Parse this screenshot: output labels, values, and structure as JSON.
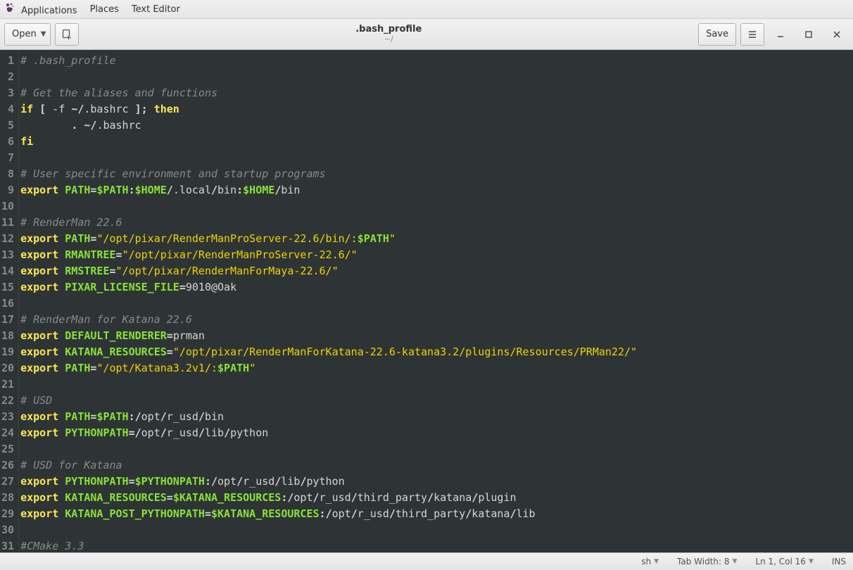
{
  "panel": {
    "applications": "Applications",
    "places": "Places",
    "texteditor": "Text Editor"
  },
  "toolbar": {
    "open": "Open",
    "save": "Save",
    "filename": ".bash_profile",
    "filepath": "~/"
  },
  "statusbar": {
    "lang": "sh",
    "tabwidth": "Tab Width: 8",
    "position": "Ln 1, Col 16",
    "ins": "INS"
  },
  "code": {
    "lines": [
      {
        "n": 1,
        "tokens": [
          [
            "comment",
            "# .bash_profile"
          ]
        ]
      },
      {
        "n": 2,
        "tokens": []
      },
      {
        "n": 3,
        "tokens": [
          [
            "comment",
            "# Get the aliases and functions"
          ]
        ]
      },
      {
        "n": 4,
        "tokens": [
          [
            "kw",
            "if"
          ],
          [
            "plain",
            " "
          ],
          [
            "op",
            "["
          ],
          [
            "plain",
            " -f "
          ],
          [
            "op",
            "~/"
          ],
          [
            "plain",
            ".bashrc "
          ],
          [
            "op",
            "];"
          ],
          [
            "plain",
            " "
          ],
          [
            "kw",
            "then"
          ]
        ]
      },
      {
        "n": 5,
        "tokens": [
          [
            "plain",
            "        "
          ],
          [
            "op",
            ". ~/"
          ],
          [
            "plain",
            ".bashrc"
          ]
        ]
      },
      {
        "n": 6,
        "tokens": [
          [
            "kw",
            "fi"
          ]
        ]
      },
      {
        "n": 7,
        "tokens": []
      },
      {
        "n": 8,
        "tokens": [
          [
            "comment",
            "# User specific environment and startup programs"
          ]
        ]
      },
      {
        "n": 9,
        "tokens": [
          [
            "kw",
            "export"
          ],
          [
            "plain",
            " "
          ],
          [
            "var",
            "PATH"
          ],
          [
            "op",
            "="
          ],
          [
            "env",
            "$PATH"
          ],
          [
            "op",
            ":"
          ],
          [
            "env",
            "$HOME"
          ],
          [
            "op",
            "/"
          ],
          [
            "plain",
            ".local"
          ],
          [
            "op",
            "/"
          ],
          [
            "plain",
            "bin"
          ],
          [
            "op",
            ":"
          ],
          [
            "env",
            "$HOME"
          ],
          [
            "op",
            "/"
          ],
          [
            "plain",
            "bin"
          ]
        ]
      },
      {
        "n": 10,
        "tokens": []
      },
      {
        "n": 11,
        "tokens": [
          [
            "comment",
            "# RenderMan 22.6"
          ]
        ]
      },
      {
        "n": 12,
        "tokens": [
          [
            "kw",
            "export"
          ],
          [
            "plain",
            " "
          ],
          [
            "var",
            "PATH"
          ],
          [
            "op",
            "="
          ],
          [
            "str",
            "\"/opt/pixar/RenderManProServer-22.6/bin/:"
          ],
          [
            "env",
            "$PATH"
          ],
          [
            "str",
            "\""
          ]
        ]
      },
      {
        "n": 13,
        "tokens": [
          [
            "kw",
            "export"
          ],
          [
            "plain",
            " "
          ],
          [
            "var",
            "RMANTREE"
          ],
          [
            "op",
            "="
          ],
          [
            "str",
            "\"/opt/pixar/RenderManProServer-22.6/\""
          ]
        ]
      },
      {
        "n": 14,
        "tokens": [
          [
            "kw",
            "export"
          ],
          [
            "plain",
            " "
          ],
          [
            "var",
            "RMSTREE"
          ],
          [
            "op",
            "="
          ],
          [
            "str",
            "\"/opt/pixar/RenderManForMaya-22.6/\""
          ]
        ]
      },
      {
        "n": 15,
        "tokens": [
          [
            "kw",
            "export"
          ],
          [
            "plain",
            " "
          ],
          [
            "var",
            "PIXAR_LICENSE_FILE"
          ],
          [
            "op",
            "="
          ],
          [
            "plain",
            "9010@Oak"
          ]
        ]
      },
      {
        "n": 16,
        "tokens": []
      },
      {
        "n": 17,
        "tokens": [
          [
            "comment",
            "# RenderMan for Katana 22.6"
          ]
        ]
      },
      {
        "n": 18,
        "tokens": [
          [
            "kw",
            "export"
          ],
          [
            "plain",
            " "
          ],
          [
            "var",
            "DEFAULT_RENDERER"
          ],
          [
            "op",
            "="
          ],
          [
            "plain",
            "prman"
          ]
        ]
      },
      {
        "n": 19,
        "tokens": [
          [
            "kw",
            "export"
          ],
          [
            "plain",
            " "
          ],
          [
            "var",
            "KATANA_RESOURCES"
          ],
          [
            "op",
            "="
          ],
          [
            "str",
            "\"/opt/pixar/RenderManForKatana-22.6-katana3.2/plugins/Resources/PRMan22/\""
          ]
        ]
      },
      {
        "n": 20,
        "tokens": [
          [
            "kw",
            "export"
          ],
          [
            "plain",
            " "
          ],
          [
            "var",
            "PATH"
          ],
          [
            "op",
            "="
          ],
          [
            "str",
            "\"/opt/Katana3.2v1/:"
          ],
          [
            "env",
            "$PATH"
          ],
          [
            "str",
            "\""
          ]
        ]
      },
      {
        "n": 21,
        "tokens": []
      },
      {
        "n": 22,
        "tokens": [
          [
            "comment",
            "# USD"
          ]
        ]
      },
      {
        "n": 23,
        "tokens": [
          [
            "kw",
            "export"
          ],
          [
            "plain",
            " "
          ],
          [
            "var",
            "PATH"
          ],
          [
            "op",
            "="
          ],
          [
            "env",
            "$PATH"
          ],
          [
            "op",
            ":/"
          ],
          [
            "plain",
            "opt"
          ],
          [
            "op",
            "/"
          ],
          [
            "plain",
            "r_usd"
          ],
          [
            "op",
            "/"
          ],
          [
            "plain",
            "bin"
          ]
        ]
      },
      {
        "n": 24,
        "tokens": [
          [
            "kw",
            "export"
          ],
          [
            "plain",
            " "
          ],
          [
            "var",
            "PYTHONPATH"
          ],
          [
            "op",
            "=/"
          ],
          [
            "plain",
            "opt"
          ],
          [
            "op",
            "/"
          ],
          [
            "plain",
            "r_usd"
          ],
          [
            "op",
            "/"
          ],
          [
            "plain",
            "lib"
          ],
          [
            "op",
            "/"
          ],
          [
            "plain",
            "python"
          ]
        ]
      },
      {
        "n": 25,
        "tokens": []
      },
      {
        "n": 26,
        "tokens": [
          [
            "comment",
            "# USD for Katana"
          ]
        ]
      },
      {
        "n": 27,
        "tokens": [
          [
            "kw",
            "export"
          ],
          [
            "plain",
            " "
          ],
          [
            "var",
            "PYTHONPATH"
          ],
          [
            "op",
            "="
          ],
          [
            "env",
            "$PYTHONPATH"
          ],
          [
            "op",
            ":/"
          ],
          [
            "plain",
            "opt"
          ],
          [
            "op",
            "/"
          ],
          [
            "plain",
            "r_usd"
          ],
          [
            "op",
            "/"
          ],
          [
            "plain",
            "lib"
          ],
          [
            "op",
            "/"
          ],
          [
            "plain",
            "python"
          ]
        ]
      },
      {
        "n": 28,
        "tokens": [
          [
            "kw",
            "export"
          ],
          [
            "plain",
            " "
          ],
          [
            "var",
            "KATANA_RESOURCES"
          ],
          [
            "op",
            "="
          ],
          [
            "env",
            "$KATANA_RESOURCES"
          ],
          [
            "op",
            ":/"
          ],
          [
            "plain",
            "opt"
          ],
          [
            "op",
            "/"
          ],
          [
            "plain",
            "r_usd"
          ],
          [
            "op",
            "/"
          ],
          [
            "plain",
            "third_party"
          ],
          [
            "op",
            "/"
          ],
          [
            "plain",
            "katana"
          ],
          [
            "op",
            "/"
          ],
          [
            "plain",
            "plugin"
          ]
        ]
      },
      {
        "n": 29,
        "tokens": [
          [
            "kw",
            "export"
          ],
          [
            "plain",
            " "
          ],
          [
            "var",
            "KATANA_POST_PYTHONPATH"
          ],
          [
            "op",
            "="
          ],
          [
            "env",
            "$KATANA_RESOURCES"
          ],
          [
            "op",
            ":/"
          ],
          [
            "plain",
            "opt"
          ],
          [
            "op",
            "/"
          ],
          [
            "plain",
            "r_usd"
          ],
          [
            "op",
            "/"
          ],
          [
            "plain",
            "third_party"
          ],
          [
            "op",
            "/"
          ],
          [
            "plain",
            "katana"
          ],
          [
            "op",
            "/"
          ],
          [
            "plain",
            "lib"
          ]
        ]
      },
      {
        "n": 30,
        "tokens": []
      },
      {
        "n": 31,
        "tokens": [
          [
            "comment",
            "#CMake 3.3"
          ]
        ]
      }
    ]
  }
}
